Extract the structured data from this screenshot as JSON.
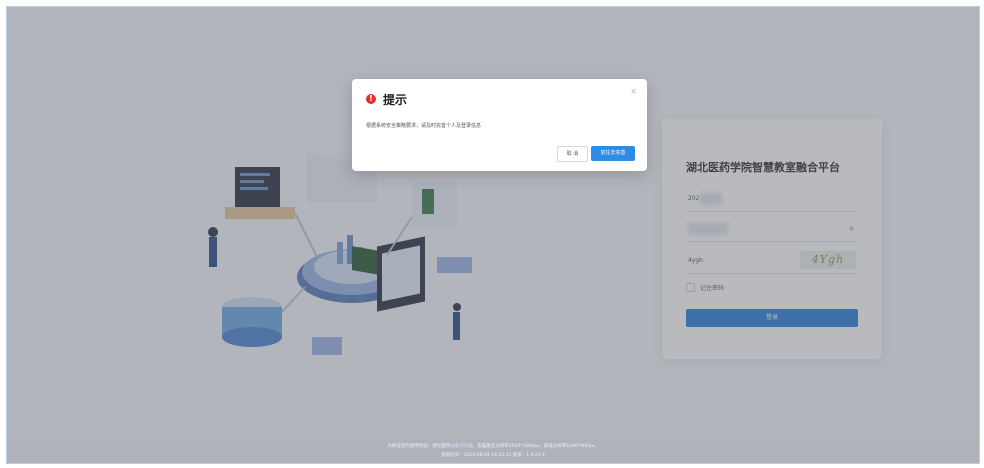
{
  "login": {
    "title": "湖北医药学院智慧教室融合平台",
    "username_value": "202",
    "captcha_input_value": "4ygh",
    "captcha_image_text": "4Ygh",
    "remember_label": "记住密码",
    "login_button": "登录"
  },
  "modal": {
    "title": "提示",
    "message": "根据系统安全策略要求，请及时完善个人及登录信息",
    "cancel_label": "取 消",
    "confirm_label": "前往去完善",
    "icon": "alert-icon",
    "close_icon": "close-icon"
  },
  "footer": {
    "line1_prefix": "为保证您的使用体验，建议使用",
    "line1_link": "谷歌浏览器",
    "line1_suffix": "，电脑最佳分辨率1920*1080px，最低分辨率1440*900px。",
    "line2": "系统时间：2023-08-04 14:23:11   版本：1.0.24.4"
  },
  "colors": {
    "primary": "#2d8ce3",
    "danger": "#e0332e",
    "overlay": "rgba(85,90,100,0.42)"
  }
}
